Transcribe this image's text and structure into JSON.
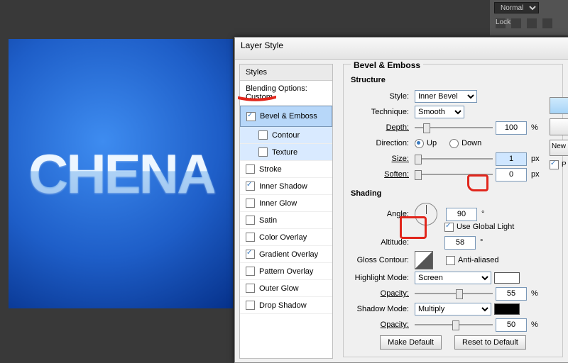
{
  "dialog": {
    "title": "Layer Style",
    "stylelist": {
      "head": "Styles",
      "blending": "Blending Options: Custom",
      "items": [
        {
          "label": "Bevel & Emboss",
          "checked": true,
          "selected": true
        },
        {
          "label": "Contour",
          "checked": false,
          "sub": true
        },
        {
          "label": "Texture",
          "checked": false,
          "sub": true
        },
        {
          "label": "Stroke",
          "checked": false
        },
        {
          "label": "Inner Shadow",
          "checked": true
        },
        {
          "label": "Inner Glow",
          "checked": false
        },
        {
          "label": "Satin",
          "checked": false
        },
        {
          "label": "Color Overlay",
          "checked": false
        },
        {
          "label": "Gradient Overlay",
          "checked": true
        },
        {
          "label": "Pattern Overlay",
          "checked": false
        },
        {
          "label": "Outer Glow",
          "checked": false
        },
        {
          "label": "Drop Shadow",
          "checked": false
        }
      ]
    },
    "structure": {
      "group_title": "Bevel & Emboss",
      "section": "Structure",
      "style_label": "Style:",
      "style_value": "Inner Bevel",
      "tech_label": "Technique:",
      "tech_value": "Smooth",
      "depth_label": "Depth:",
      "depth_value": "100",
      "depth_unit": "%",
      "dir_label": "Direction:",
      "dir_up": "Up",
      "dir_down": "Down",
      "size_label": "Size:",
      "size_value": "1",
      "size_unit": "px",
      "soften_label": "Soften:",
      "soften_value": "0",
      "soften_unit": "px"
    },
    "shading": {
      "section": "Shading",
      "angle_label": "Angle:",
      "angle_value": "90",
      "deg": "°",
      "global_label": "Use Global Light",
      "global_checked": true,
      "alt_label": "Altitude:",
      "alt_value": "58",
      "gloss_label": "Gloss Contour:",
      "aa_label": "Anti-aliased",
      "hl_label": "Highlight Mode:",
      "hl_value": "Screen",
      "hl_color": "#ffffff",
      "hl_op_label": "Opacity:",
      "hl_op_value": "55",
      "pct": "%",
      "sh_label": "Shadow Mode:",
      "sh_value": "Multiply",
      "sh_color": "#000000",
      "sh_op_label": "Opacity:",
      "sh_op_value": "50"
    },
    "buttons": {
      "make_default": "Make Default",
      "reset": "Reset to Default",
      "new": "New"
    },
    "side": {
      "preview_label": "P"
    }
  },
  "preview_text": "CHENA",
  "layers_panel": {
    "mode": "Normal",
    "lock_label": "Lock:"
  }
}
